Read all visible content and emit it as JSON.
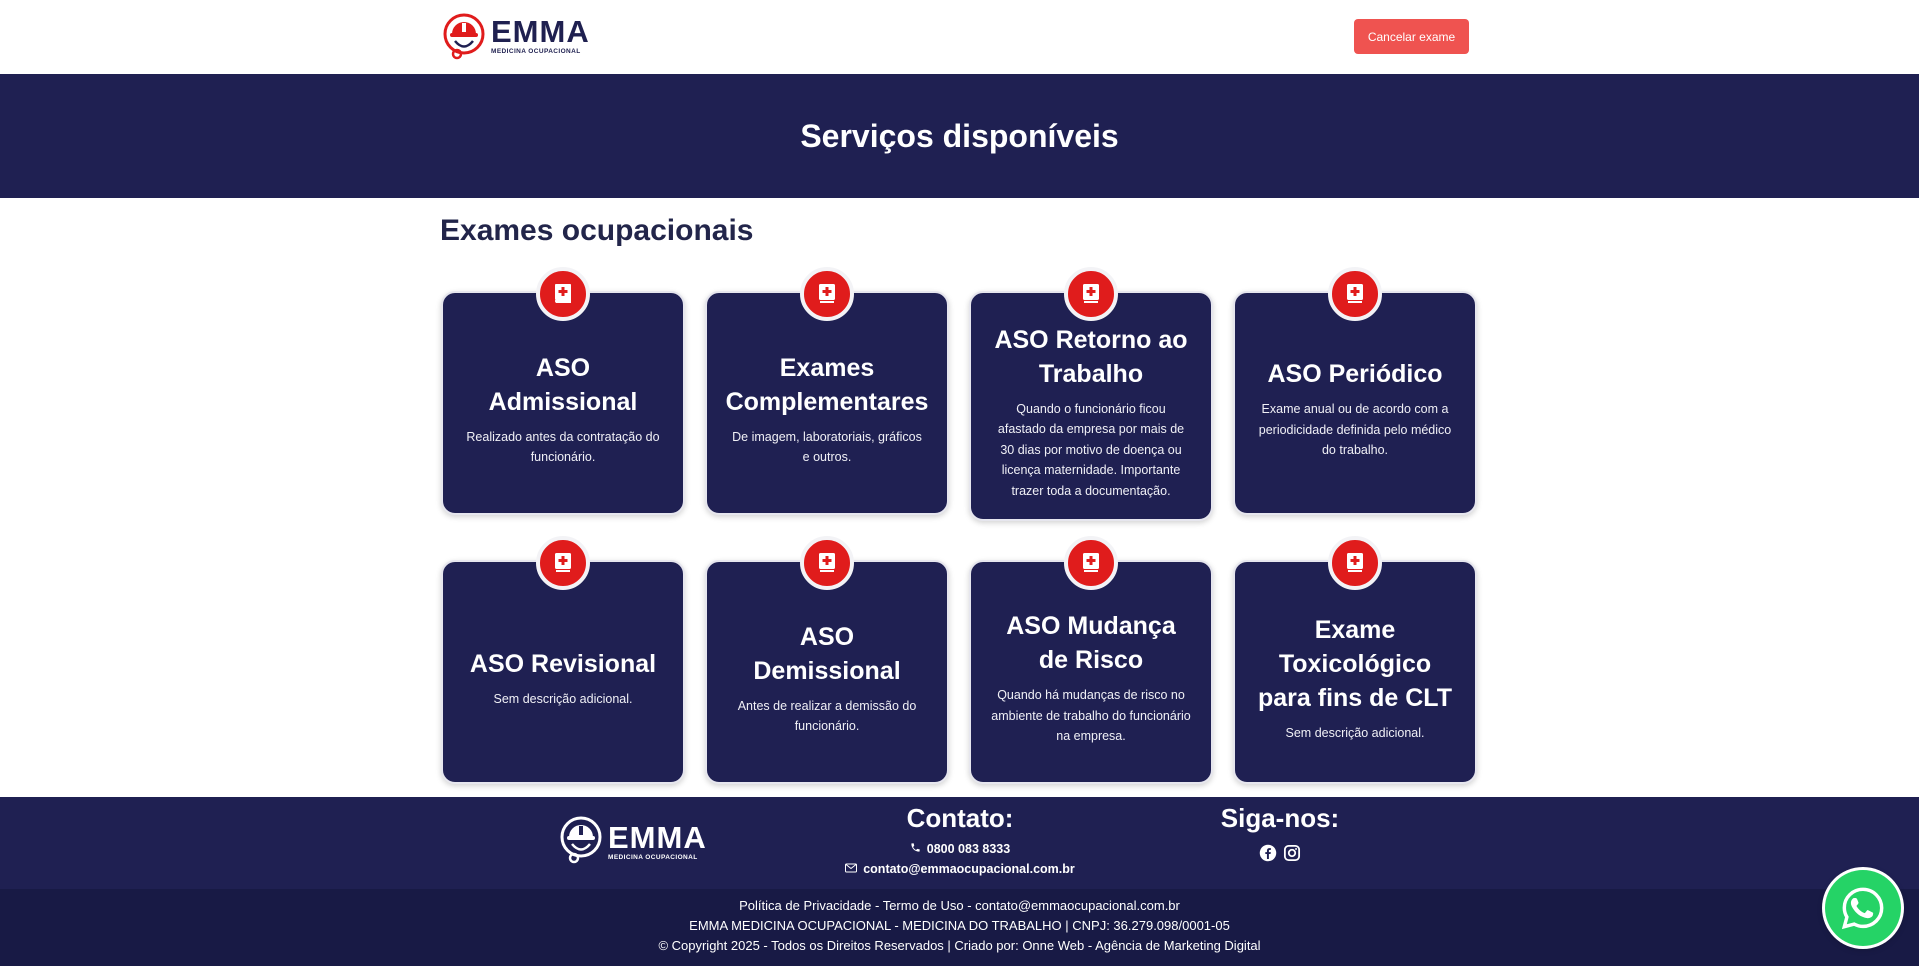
{
  "header": {
    "logo_name": "EMMA",
    "logo_sub": "MEDICINA OCUPACIONAL",
    "cancel_label": "Cancelar exame"
  },
  "hero": {
    "title": "Serviços disponíveis"
  },
  "section": {
    "title": "Exames ocupacionais"
  },
  "cards": [
    {
      "title": "ASO Admissional",
      "desc": "Realizado antes da contratação do funcionário."
    },
    {
      "title": "Exames Complementares",
      "desc": "De imagem, laboratoriais, gráficos e outros."
    },
    {
      "title": "ASO Retorno ao Trabalho",
      "desc": "Quando o funcionário ficou afastado da empresa por mais de 30 dias por motivo de doença ou licença maternidade. Importante trazer toda a documentação."
    },
    {
      "title": "ASO Periódico",
      "desc": "Exame anual ou de acordo com a periodicidade definida pelo médico do trabalho."
    },
    {
      "title": "ASO Revisional",
      "desc": "Sem descrição adicional."
    },
    {
      "title": "ASO Demissional",
      "desc": "Antes de realizar a demissão do funcionário."
    },
    {
      "title": "ASO Mudança de Risco",
      "desc": "Quando há mudanças de risco no ambiente de trabalho do funcionário na empresa."
    },
    {
      "title": "Exame Toxicológico para fins de CLT",
      "desc": "Sem descrição adicional."
    }
  ],
  "footer": {
    "logo_name": "EMMA",
    "logo_sub": "MEDICINA OCUPACIONAL",
    "contact_heading": "Contato:",
    "phone": "0800 083 8333",
    "email": "contato@emmaocupacional.com.br",
    "follow_heading": "Siga-nos:",
    "links_line": "Política de Privacidade - Termo de Uso - contato@emmaocupacional.com.br",
    "company_line": "EMMA MEDICINA OCUPACIONAL - MEDICINA DO TRABALHO | CNPJ: 36.279.098/0001-05",
    "copyright_line": "© Copyright 2025 - Todos os Direitos Reservados | Criado por: Onne Web - Agência de Marketing Digital"
  },
  "icons": {
    "card": "medical-book-icon",
    "phone": "phone-icon",
    "email": "envelope-icon",
    "social": [
      "facebook-icon",
      "instagram-icon"
    ],
    "floating": "whatsapp-icon"
  },
  "colors": {
    "navy": "#1f2052",
    "footer_dark": "#181a45",
    "accent_red": "#e01c1c",
    "button_red": "#ef5350",
    "whatsapp_green": "#25d366"
  }
}
